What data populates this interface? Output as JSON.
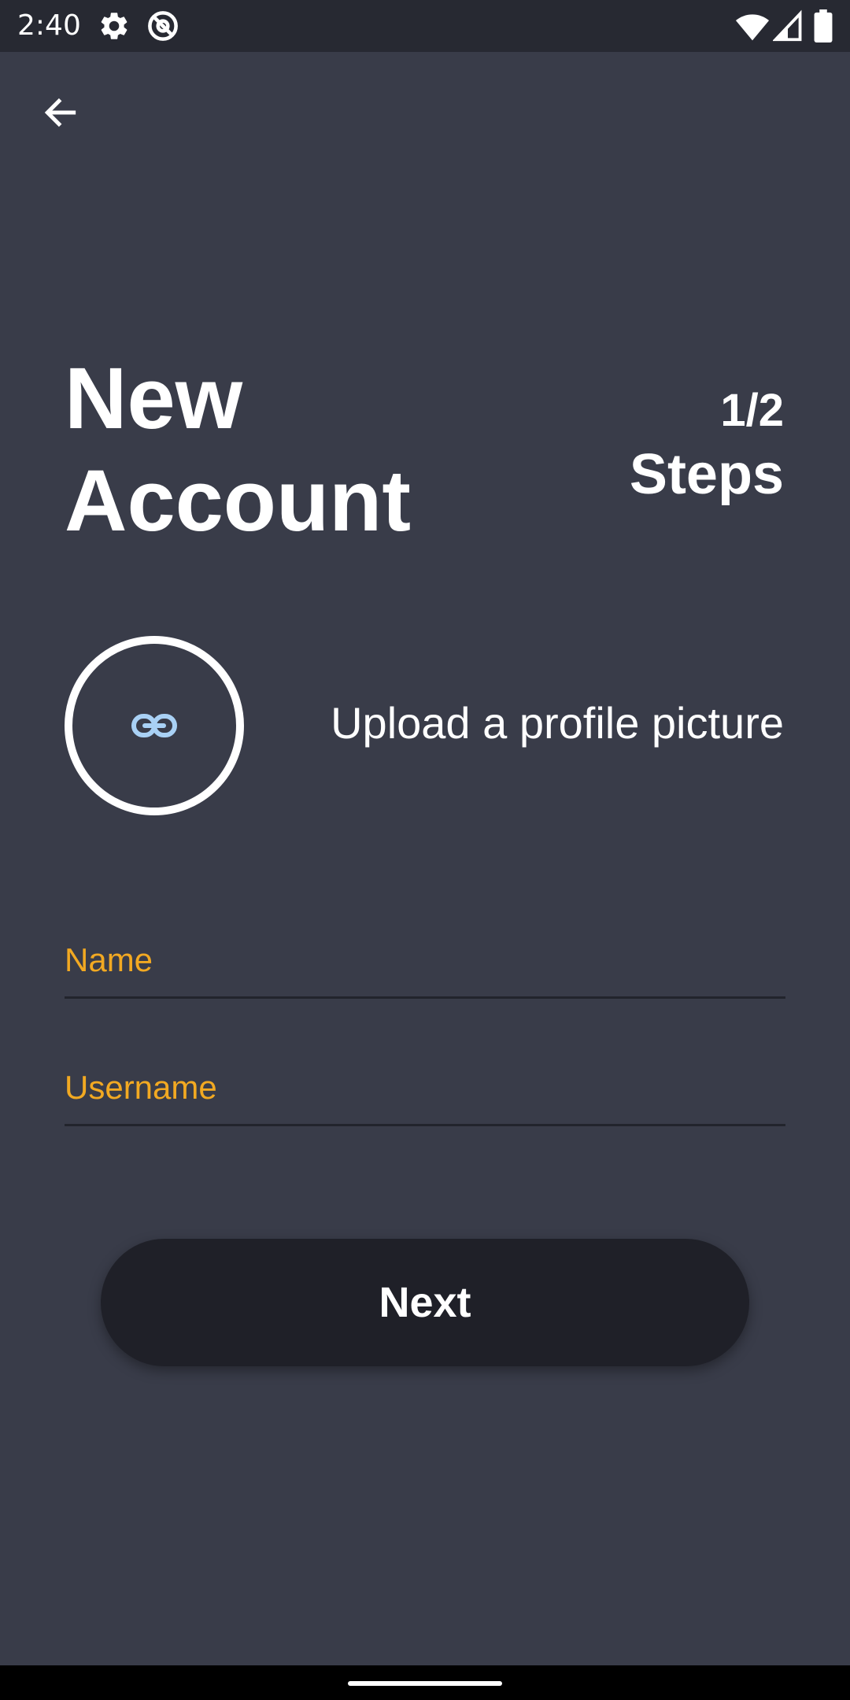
{
  "status_bar": {
    "time": "2:40",
    "icons": [
      "gear-icon",
      "at-sign-icon",
      "wifi-icon",
      "cell-signal-icon",
      "battery-icon"
    ]
  },
  "header": {
    "back_icon": "arrow-left-icon"
  },
  "title": {
    "line1": "New",
    "line2": "Account"
  },
  "steps": {
    "count": "1/2",
    "label": "Steps"
  },
  "profile_upload": {
    "icon": "link-icon",
    "label": "Upload a profile picture"
  },
  "form": {
    "name_label": "Name",
    "name_value": "",
    "username_label": "Username",
    "username_value": ""
  },
  "actions": {
    "next_label": "Next"
  },
  "colors": {
    "background": "#393c49",
    "status_bar": "#272932",
    "accent": "#f2a922",
    "button": "#1f2028",
    "link_icon": "#a9d1f5"
  }
}
